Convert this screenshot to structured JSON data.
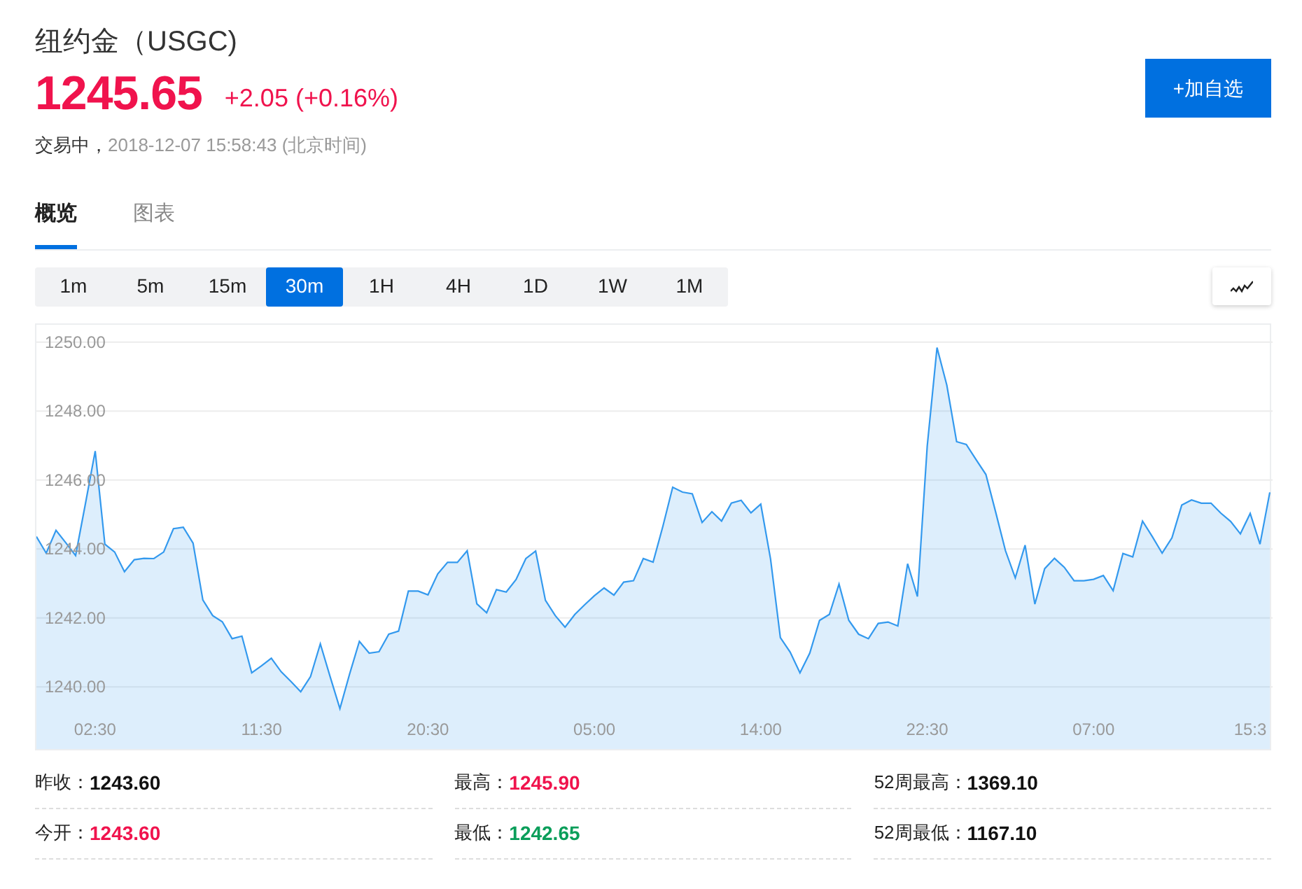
{
  "quote": {
    "title": "纽约金（USGC)",
    "price": "1245.65",
    "change": "+2.05 (+0.16%)",
    "status": "交易中，",
    "time": "2018-12-07 15:58:43 (北京时间)",
    "watch_button": "+加自选"
  },
  "tabs": [
    {
      "label": "概览",
      "selected": true
    },
    {
      "label": "图表",
      "selected": false
    }
  ],
  "timeframes": [
    {
      "label": "1m",
      "selected": false
    },
    {
      "label": "5m",
      "selected": false
    },
    {
      "label": "15m",
      "selected": false
    },
    {
      "label": "30m",
      "selected": true
    },
    {
      "label": "1H",
      "selected": false
    },
    {
      "label": "4H",
      "selected": false
    },
    {
      "label": "1D",
      "selected": false
    },
    {
      "label": "1W",
      "selected": false
    },
    {
      "label": "1M",
      "selected": false
    }
  ],
  "chart": {
    "chart_data": {
      "type": "area",
      "grid": true,
      "ylim": [
        1238.2,
        1250.5
      ],
      "categories": [
        null,
        null,
        null,
        null,
        null,
        null,
        "02:30",
        null,
        null,
        null,
        null,
        null,
        null,
        null,
        null,
        null,
        null,
        null,
        null,
        null,
        null,
        null,
        null,
        "11:30",
        null,
        null,
        null,
        null,
        null,
        null,
        null,
        null,
        null,
        null,
        null,
        null,
        null,
        null,
        null,
        null,
        "20:30",
        null,
        null,
        null,
        null,
        null,
        null,
        null,
        null,
        null,
        null,
        null,
        null,
        null,
        null,
        null,
        null,
        "05:00",
        null,
        null,
        null,
        null,
        null,
        null,
        null,
        null,
        null,
        null,
        null,
        null,
        null,
        null,
        null,
        null,
        "14:00",
        null,
        null,
        null,
        null,
        null,
        null,
        null,
        null,
        null,
        null,
        null,
        null,
        null,
        null,
        null,
        null,
        "22:30",
        null,
        null,
        null,
        null,
        null,
        null,
        null,
        null,
        null,
        null,
        null,
        null,
        null,
        null,
        null,
        null,
        "07:00",
        null,
        null,
        null,
        null,
        null,
        null,
        null,
        null,
        null,
        null,
        null,
        null,
        null,
        null,
        null,
        "15:3",
        null,
        null
      ],
      "yticks": [
        {
          "value": 1240,
          "label": "1240.00"
        },
        {
          "value": 1242,
          "label": "1242.00"
        },
        {
          "value": 1244,
          "label": "1244.00"
        },
        {
          "value": 1246,
          "label": "1246.00"
        },
        {
          "value": 1248,
          "label": "1248.00"
        },
        {
          "value": 1250,
          "label": "1250.00"
        }
      ],
      "series": [
        {
          "color": "#3399ee",
          "values": [
            1244.36,
            1243.88,
            1244.54,
            1244.18,
            1243.81,
            1245.31,
            1246.84,
            1244.14,
            1243.91,
            1243.34,
            1243.69,
            1243.73,
            1243.72,
            1243.91,
            1244.59,
            1244.63,
            1244.17,
            1242.52,
            1242.07,
            1241.89,
            1241.4,
            1241.47,
            1240.41,
            1240.61,
            1240.83,
            1240.44,
            1240.16,
            1239.86,
            1240.3,
            1241.25,
            1240.3,
            1239.37,
            1240.37,
            1241.32,
            1240.98,
            1241.02,
            1241.53,
            1241.62,
            1242.78,
            1242.78,
            1242.67,
            1243.28,
            1243.61,
            1243.61,
            1243.95,
            1242.41,
            1242.15,
            1242.82,
            1242.75,
            1243.11,
            1243.72,
            1243.94,
            1242.51,
            1242.07,
            1241.73,
            1242.1,
            1242.38,
            1242.64,
            1242.87,
            1242.66,
            1243.04,
            1243.08,
            1243.72,
            1243.62,
            1244.66,
            1245.79,
            1245.65,
            1245.6,
            1244.77,
            1245.08,
            1244.81,
            1245.33,
            1245.41,
            1245.05,
            1245.3,
            1243.71,
            1241.43,
            1241.01,
            1240.41,
            1240.98,
            1241.93,
            1242.1,
            1242.98,
            1241.93,
            1241.53,
            1241.4,
            1241.84,
            1241.88,
            1241.77,
            1243.57,
            1242.62,
            1246.98,
            1249.84,
            1248.75,
            1247.11,
            1247.03,
            1246.59,
            1246.16,
            1245.07,
            1243.95,
            1243.16,
            1244.11,
            1242.4,
            1243.43,
            1243.73,
            1243.47,
            1243.08,
            1243.08,
            1243.12,
            1243.23,
            1242.79,
            1243.87,
            1243.77,
            1244.81,
            1244.36,
            1243.88,
            1244.32,
            1245.27,
            1245.42,
            1245.33,
            1245.33,
            1245.04,
            1244.8,
            1244.44,
            1245.03,
            1244.14,
            1245.64
          ]
        }
      ]
    }
  },
  "stats": [
    {
      "label": "昨收：",
      "value": "1243.60",
      "color": "#111111"
    },
    {
      "label": "最高：",
      "value": "1245.90",
      "color": "#f0134d"
    },
    {
      "label": "52周最高：",
      "value": "1369.10",
      "color": "#111111"
    },
    {
      "label": "今开：",
      "value": "1243.60",
      "color": "#f0134d"
    },
    {
      "label": "最低：",
      "value": "1242.65",
      "color": "#0a9e5a"
    },
    {
      "label": "52周最低：",
      "value": "1167.10",
      "color": "#111111"
    }
  ]
}
